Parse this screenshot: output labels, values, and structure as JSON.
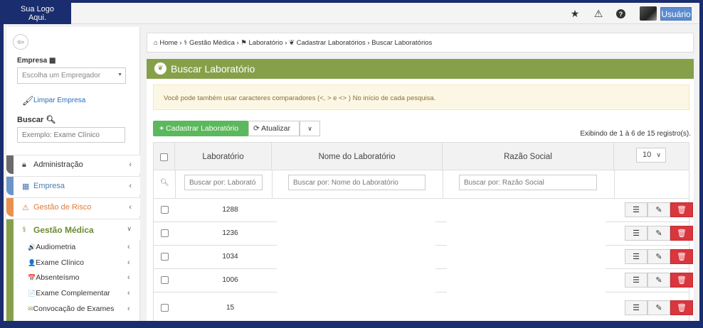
{
  "topbar": {
    "logo_line1": "Sua Logo",
    "logo_line2": "Aqui.",
    "star_icon": "★",
    "warning_icon": "⚠",
    "help_icon": "?",
    "user_label": "Usuário"
  },
  "sidebar": {
    "empresa_label": "Empresa",
    "empresa_placeholder": "Escolha um Empregador",
    "limpar_label": "Limpar Empresa",
    "buscar_label": "Buscar",
    "buscar_placeholder": "Exemplo: Exame Clínico",
    "menus": [
      {
        "label": "Administração",
        "color": "#6b6b6b",
        "text_color": "#333333"
      },
      {
        "label": "Empresa",
        "color": "#6b95c9",
        "text_color": "#4a7bb7"
      },
      {
        "label": "Gestão de Risco",
        "color": "#e8914f",
        "text_color": "#e07b39"
      },
      {
        "label": "Gestão Médica",
        "color": "#86a04a",
        "text_color": "#6b8a33"
      }
    ],
    "submenus": [
      {
        "label": "Audiometria",
        "icon": "🔊"
      },
      {
        "label": "Exame Clínico",
        "icon": "👤"
      },
      {
        "label": "Absenteísmo",
        "icon": "📅"
      },
      {
        "label": "Exame Complementar",
        "icon": "📄"
      },
      {
        "label": "Convocação de Exames",
        "icon": "✉"
      }
    ]
  },
  "breadcrumb": {
    "home": "Home",
    "gestao": "Gestão Médica",
    "laboratorio": "Laboratório",
    "cadastrar": "Cadastrar Laboratórios",
    "current": "Buscar Laboratórios"
  },
  "panel": {
    "title": "Buscar Laboratório",
    "alert": "Você pode também usar caracteres comparadores (<, > e <> ) No início de cada pesquisa.",
    "btn_cadastrar": "Cadastrar Laboratório",
    "btn_atualizar": "Atualizar",
    "count_text": "Exibindo de 1 à 6 de 15 registro(s).",
    "page_size": "10"
  },
  "table": {
    "columns": [
      "Laboratório",
      "Nome do Laboratório",
      "Razão Social"
    ],
    "filters": [
      "Buscar por: Laborató",
      "Buscar por: Nome do Laboratório",
      "Buscar por: Razão Social"
    ],
    "rows": [
      {
        "id": "1288"
      },
      {
        "id": "1236"
      },
      {
        "id": "1034"
      },
      {
        "id": "1006"
      },
      {
        "id": "15"
      }
    ]
  }
}
